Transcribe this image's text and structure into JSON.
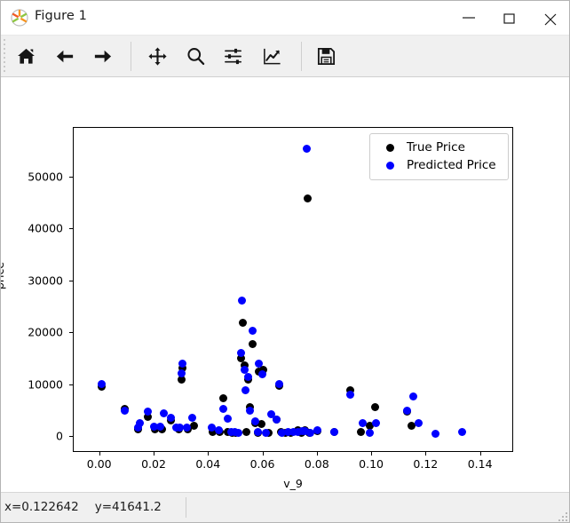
{
  "window": {
    "title": "Figure 1",
    "app_icon": "matplotlib-logo-icon",
    "minimize_label": "–",
    "maximize_label": "□",
    "close_label": "✕"
  },
  "toolbar": {
    "buttons": [
      {
        "name": "home-icon",
        "tooltip": "Home"
      },
      {
        "name": "back-arrow-icon",
        "tooltip": "Back"
      },
      {
        "name": "forward-arrow-icon",
        "tooltip": "Forward"
      },
      {
        "name": "pan-move-icon",
        "tooltip": "Pan"
      },
      {
        "name": "zoom-magnifier-icon",
        "tooltip": "Zoom to rectangle"
      },
      {
        "name": "subplot-sliders-icon",
        "tooltip": "Configure subplots"
      },
      {
        "name": "edit-axis-chart-icon",
        "tooltip": "Edit axis, curve and image parameters"
      },
      {
        "name": "save-floppy-icon",
        "tooltip": "Save the figure"
      }
    ]
  },
  "statusbar": {
    "x_readout": "x=0.122642",
    "y_readout": "y=41641.2"
  },
  "colors": {
    "true_price": "#000000",
    "predicted_price": "#0000ff",
    "figure_background": "#ffffff",
    "toolbar_background": "#f0f0f0",
    "axes_edge": "#000000"
  },
  "chart_data": {
    "type": "scatter",
    "title": "",
    "xlabel": "v_9",
    "ylabel": "price",
    "xlim": [
      -0.0097,
      0.1522
    ],
    "ylim": [
      -3100,
      59600
    ],
    "xticks": [
      0.0,
      0.02,
      0.04,
      0.06,
      0.08,
      0.1,
      0.12,
      0.14
    ],
    "xticklabels": [
      "0.00",
      "0.02",
      "0.04",
      "0.06",
      "0.08",
      "0.10",
      "0.12",
      "0.14"
    ],
    "yticks": [
      0,
      10000,
      20000,
      30000,
      40000,
      50000
    ],
    "yticklabels": [
      "0",
      "10000",
      "20000",
      "30000",
      "40000",
      "50000"
    ],
    "grid": false,
    "legend_position": "upper right",
    "marker_size_px": 9,
    "series": [
      {
        "name": "True Price",
        "label": "True Price",
        "color": "#000000",
        "points": [
          [
            0.0005,
            9600
          ],
          [
            0.0092,
            5400
          ],
          [
            0.014,
            1500
          ],
          [
            0.0175,
            3800
          ],
          [
            0.0203,
            1500
          ],
          [
            0.0228,
            1500
          ],
          [
            0.0262,
            3200
          ],
          [
            0.029,
            1400
          ],
          [
            0.03,
            11000
          ],
          [
            0.0303,
            13200
          ],
          [
            0.0322,
            1400
          ],
          [
            0.0345,
            2100
          ],
          [
            0.0415,
            1000
          ],
          [
            0.044,
            1000
          ],
          [
            0.0452,
            7400
          ],
          [
            0.047,
            900
          ],
          [
            0.0487,
            800
          ],
          [
            0.05,
            800
          ],
          [
            0.0519,
            15100
          ],
          [
            0.0525,
            22000
          ],
          [
            0.053,
            13800
          ],
          [
            0.0538,
            900
          ],
          [
            0.0545,
            11000
          ],
          [
            0.0551,
            5800
          ],
          [
            0.0562,
            17900
          ],
          [
            0.057,
            2700
          ],
          [
            0.058,
            800
          ],
          [
            0.0585,
            12500
          ],
          [
            0.0592,
            2500
          ],
          [
            0.06,
            13000
          ],
          [
            0.062,
            800
          ],
          [
            0.065,
            3300
          ],
          [
            0.0659,
            9800
          ],
          [
            0.0665,
            900
          ],
          [
            0.068,
            800
          ],
          [
            0.07,
            800
          ],
          [
            0.0728,
            1300
          ],
          [
            0.074,
            800
          ],
          [
            0.0752,
            1300
          ],
          [
            0.0762,
            46000
          ],
          [
            0.0768,
            800
          ],
          [
            0.08,
            1100
          ],
          [
            0.086,
            900
          ],
          [
            0.092,
            9000
          ],
          [
            0.096,
            1000
          ],
          [
            0.099,
            2200
          ],
          [
            0.101,
            5700
          ],
          [
            0.113,
            4900
          ],
          [
            0.1145,
            2200
          ]
        ]
      },
      {
        "name": "Predicted Price",
        "label": "Predicted Price",
        "color": "#0000ff",
        "points": [
          [
            0.0005,
            10100
          ],
          [
            0.0092,
            5100
          ],
          [
            0.014,
            1700
          ],
          [
            0.0147,
            2700
          ],
          [
            0.0175,
            4800
          ],
          [
            0.02,
            2000
          ],
          [
            0.0222,
            2000
          ],
          [
            0.0235,
            4600
          ],
          [
            0.0262,
            3600
          ],
          [
            0.028,
            1700
          ],
          [
            0.0292,
            1700
          ],
          [
            0.0298,
            12300
          ],
          [
            0.0304,
            14200
          ],
          [
            0.032,
            1700
          ],
          [
            0.0338,
            3600
          ],
          [
            0.0412,
            1700
          ],
          [
            0.0436,
            1300
          ],
          [
            0.0452,
            5300
          ],
          [
            0.0468,
            3500
          ],
          [
            0.0482,
            900
          ],
          [
            0.0496,
            900
          ],
          [
            0.051,
            800
          ],
          [
            0.0519,
            16200
          ],
          [
            0.0523,
            26300
          ],
          [
            0.053,
            13000
          ],
          [
            0.0536,
            8900
          ],
          [
            0.0545,
            11600
          ],
          [
            0.0551,
            5000
          ],
          [
            0.056,
            20400
          ],
          [
            0.057,
            2900
          ],
          [
            0.058,
            900
          ],
          [
            0.0585,
            14200
          ],
          [
            0.0598,
            12000
          ],
          [
            0.061,
            800
          ],
          [
            0.0628,
            4300
          ],
          [
            0.065,
            3300
          ],
          [
            0.0659,
            10100
          ],
          [
            0.067,
            800
          ],
          [
            0.069,
            1000
          ],
          [
            0.071,
            1000
          ],
          [
            0.0728,
            1000
          ],
          [
            0.0742,
            1100
          ],
          [
            0.0752,
            1100
          ],
          [
            0.076,
            55500
          ],
          [
            0.0772,
            800
          ],
          [
            0.08,
            1200
          ],
          [
            0.0862,
            900
          ],
          [
            0.092,
            8200
          ],
          [
            0.0965,
            2700
          ],
          [
            0.099,
            800
          ],
          [
            0.1015,
            2700
          ],
          [
            0.113,
            5100
          ],
          [
            0.1152,
            7800
          ],
          [
            0.117,
            2700
          ],
          [
            0.1232,
            600
          ],
          [
            0.133,
            900
          ]
        ]
      }
    ]
  }
}
